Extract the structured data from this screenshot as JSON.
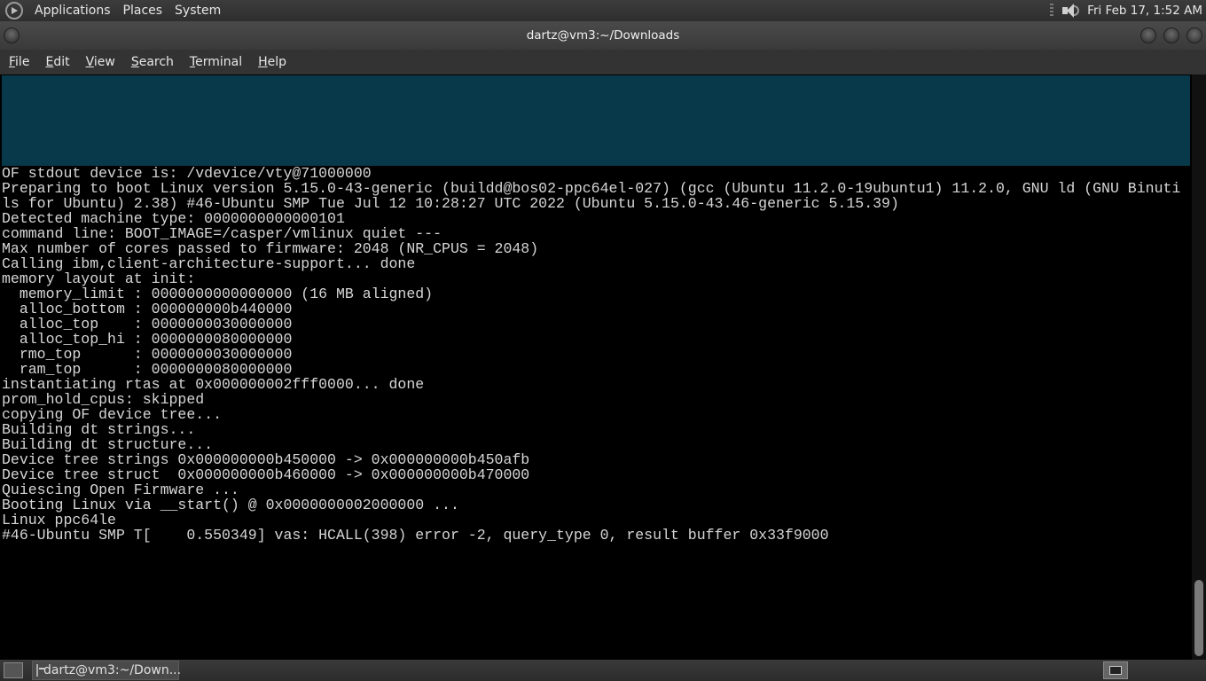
{
  "top_panel": {
    "menus": [
      "Applications",
      "Places",
      "System"
    ],
    "clock": "Fri Feb 17,  1:52 AM"
  },
  "window": {
    "title": "dartz@vm3:~/Downloads",
    "menubar": [
      {
        "label": "File",
        "mnemonic": "F",
        "rest": "ile"
      },
      {
        "label": "Edit",
        "mnemonic": "E",
        "rest": "dit"
      },
      {
        "label": "View",
        "mnemonic": "V",
        "rest": "iew"
      },
      {
        "label": "Search",
        "mnemonic": "S",
        "rest": "earch"
      },
      {
        "label": "Terminal",
        "mnemonic": "T",
        "rest": "erminal"
      },
      {
        "label": "Help",
        "mnemonic": "H",
        "rest": "elp"
      }
    ]
  },
  "terminal": {
    "background_color": "#000000",
    "text_color": "#d6d6d6",
    "cyan_block_color": "#08394a",
    "lines": [
      "OF stdout device is: /vdevice/vty@71000000",
      "Preparing to boot Linux version 5.15.0-43-generic (buildd@bos02-ppc64el-027) (gcc (Ubuntu 11.2.0-19ubuntu1) 11.2.0, GNU ld (GNU Binuti",
      "ls for Ubuntu) 2.38) #46-Ubuntu SMP Tue Jul 12 10:28:27 UTC 2022 (Ubuntu 5.15.0-43.46-generic 5.15.39)",
      "Detected machine type: 0000000000000101",
      "command line: BOOT_IMAGE=/casper/vmlinux quiet ---",
      "Max number of cores passed to firmware: 2048 (NR_CPUS = 2048)",
      "Calling ibm,client-architecture-support... done",
      "memory layout at init:",
      "  memory_limit : 0000000000000000 (16 MB aligned)",
      "  alloc_bottom : 000000000b440000",
      "  alloc_top    : 0000000030000000",
      "  alloc_top_hi : 0000000080000000",
      "  rmo_top      : 0000000030000000",
      "  ram_top      : 0000000080000000",
      "instantiating rtas at 0x000000002fff0000... done",
      "prom_hold_cpus: skipped",
      "copying OF device tree...",
      "Building dt strings...",
      "Building dt structure...",
      "Device tree strings 0x000000000b450000 -> 0x000000000b450afb",
      "Device tree struct  0x000000000b460000 -> 0x000000000b470000",
      "Quiescing Open Firmware ...",
      "Booting Linux via __start() @ 0x0000000002000000 ...",
      "Linux ppc64le",
      "#46-Ubuntu SMP T[    0.550349] vas: HCALL(398) error -2, query_type 0, result buffer 0x33f9000"
    ],
    "scroll_position": 1.0,
    "scroll_visible_fraction": 0.13
  },
  "bottom_panel": {
    "task_label": "dartz@vm3:~/Down..."
  }
}
